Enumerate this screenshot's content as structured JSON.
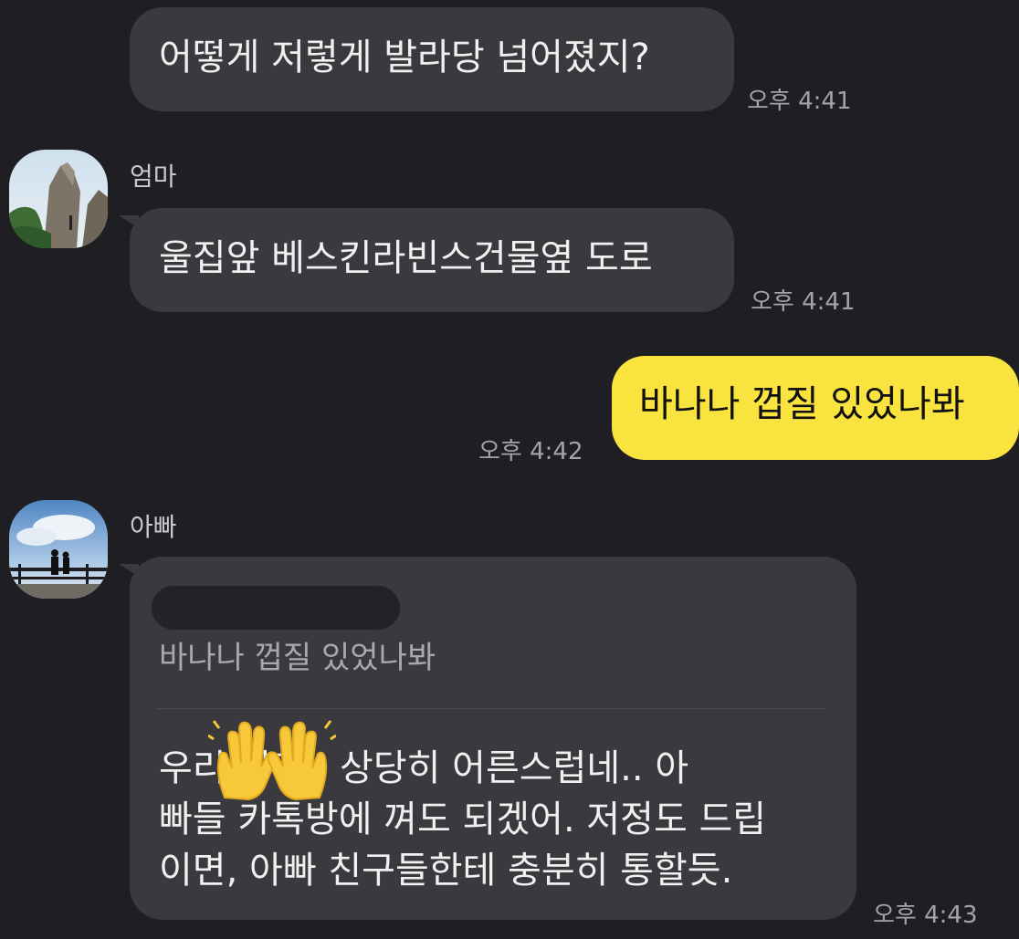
{
  "messages": [
    {
      "id": "m1",
      "side": "in",
      "text": "어떻게 저렇게 발라당 넘어졌지?",
      "time": "오후 4:41"
    },
    {
      "id": "m2",
      "side": "in",
      "sender": "엄마",
      "avatar_icon": "mountain-rock-photo-icon",
      "text": "울집앞 베스킨라빈스건물옆 도로",
      "time": "오후 4:41"
    },
    {
      "id": "m3",
      "side": "out",
      "text": "바나나 껍질 있었나봐",
      "time": "오후 4:42"
    },
    {
      "id": "m4",
      "side": "in",
      "sender": "아빠",
      "avatar_icon": "sky-lookout-photo-icon",
      "reply_quote": "바나나 껍질 있었나봐",
      "body_lines": [
        "우리     이가.. 상당히 어른스럽네.. 아",
        "빠들 카톡방에 껴도 되겠어. 저정도 드립",
        "이면, 아빠 친구들한테 충분히 통할듯."
      ],
      "emoji": "raised-hands-emoji",
      "time": "오후 4:43"
    }
  ],
  "colors": {
    "background": "#1f1e23",
    "incoming_bubble": "#3a393e",
    "outgoing_bubble": "#f9e33f",
    "time_text": "#a5a4aa"
  }
}
